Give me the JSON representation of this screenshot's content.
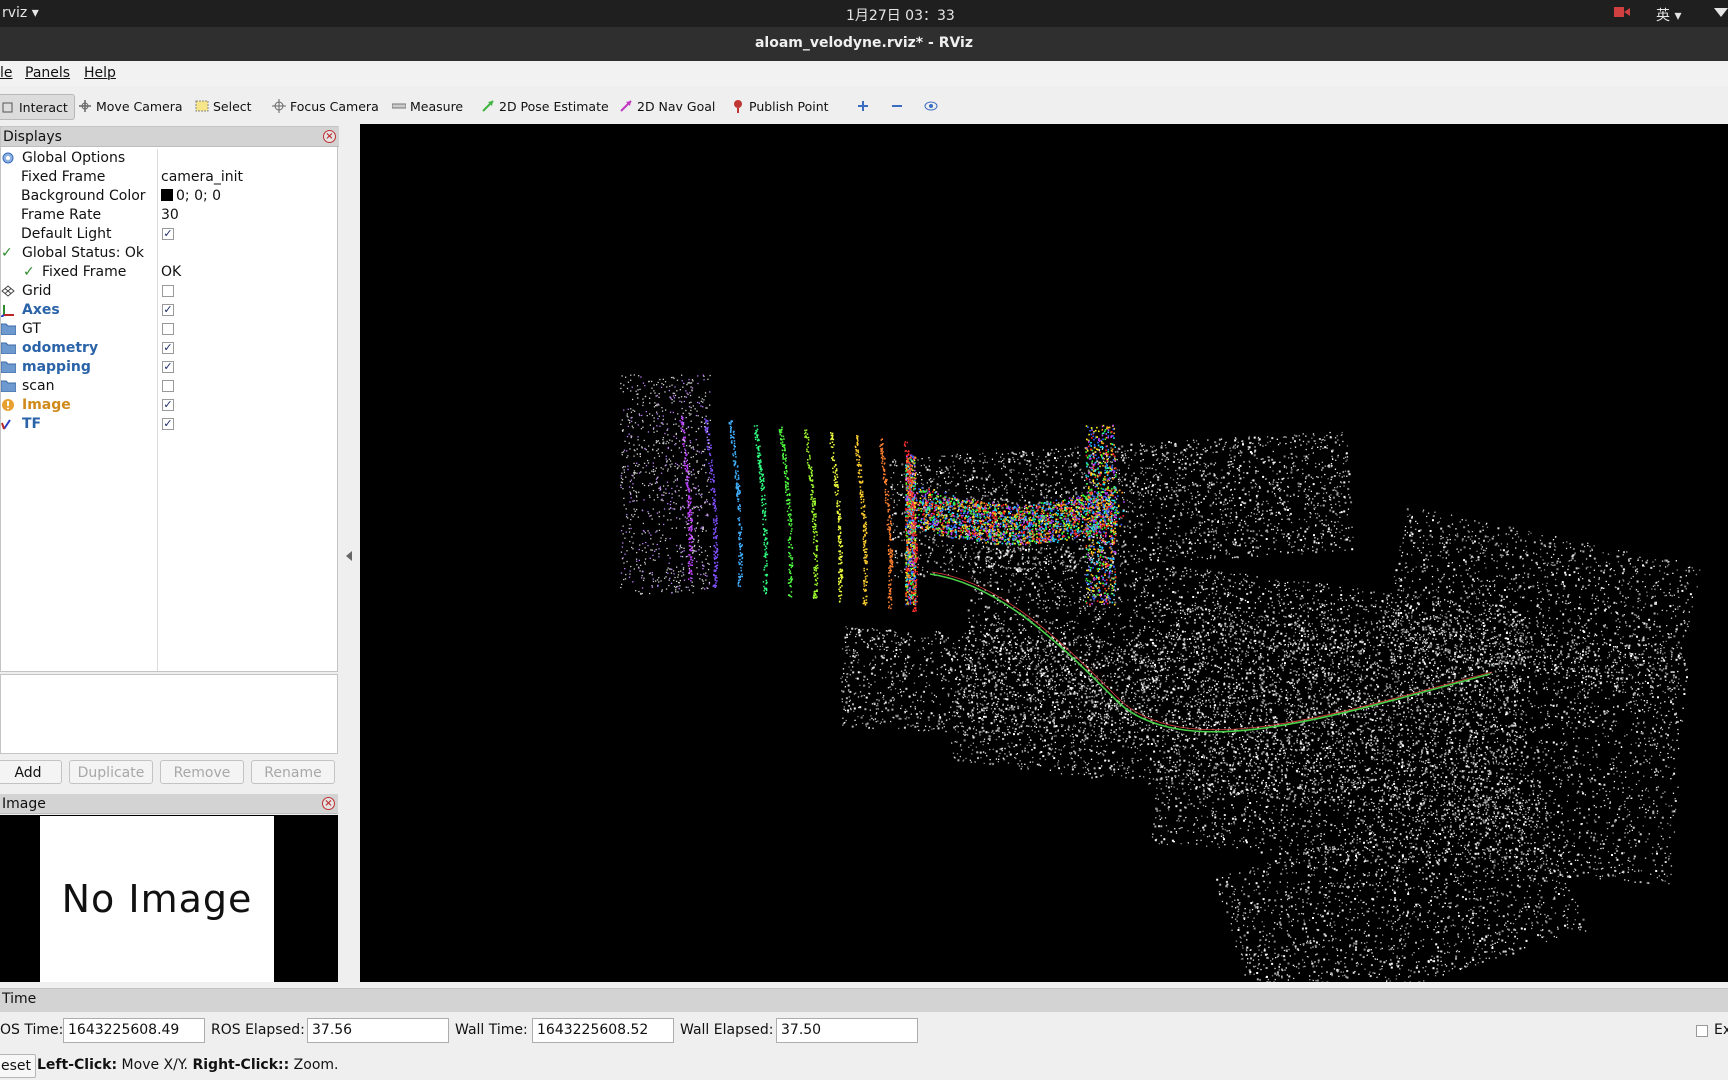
{
  "system_bar": {
    "app_menu": "rviz ▾",
    "clock": "1月27日 03：33",
    "input_method": "英 ▾"
  },
  "window": {
    "title": "aloam_velodyne.rviz* - RViz"
  },
  "menu": {
    "file": "le",
    "panels": "Panels",
    "help": "Help"
  },
  "toolbar": {
    "interact": "Interact",
    "move_camera": "Move Camera",
    "select": "Select",
    "focus_camera": "Focus Camera",
    "measure": "Measure",
    "pose_estimate": "2D Pose Estimate",
    "nav_goal": "2D Nav Goal",
    "publish_point": "Publish Point"
  },
  "displays": {
    "title": "Displays",
    "global_options": "Global Options",
    "fixed_frame": {
      "label": "Fixed Frame",
      "value": "camera_init"
    },
    "background_color": {
      "label": "Background Color",
      "value": "0; 0; 0"
    },
    "frame_rate": {
      "label": "Frame Rate",
      "value": "30"
    },
    "default_light": {
      "label": "Default Light",
      "checked": true
    },
    "global_status": "Global Status: Ok",
    "status_fixed_frame": {
      "label": "Fixed Frame",
      "value": "OK"
    },
    "items": [
      {
        "label": "Grid",
        "checked": false
      },
      {
        "label": "Axes",
        "checked": true
      },
      {
        "label": "GT",
        "checked": false
      },
      {
        "label": "odometry",
        "checked": true
      },
      {
        "label": "mapping",
        "checked": true
      },
      {
        "label": "scan",
        "checked": false
      },
      {
        "label": "Image",
        "checked": true
      },
      {
        "label": "TF",
        "checked": true
      }
    ],
    "add": "Add",
    "duplicate": "Duplicate",
    "remove": "Remove",
    "rename": "Rename"
  },
  "image_panel": {
    "title": "Image",
    "placeholder": "No Image"
  },
  "time_panel": {
    "title": "Time",
    "ros_time_label": "OS Time:",
    "ros_time": "1643225608.49",
    "ros_elapsed_label": "ROS Elapsed:",
    "ros_elapsed": "37.56",
    "wall_time_label": "Wall Time:",
    "wall_time": "1643225608.52",
    "wall_elapsed_label": "Wall Elapsed:",
    "wall_elapsed": "37.50",
    "experimental": "Ex"
  },
  "status": {
    "reset": "eset",
    "hint_left_bold": "Left-Click:",
    "hint_left": " Move X/Y.",
    "hint_right_bold": "Right-Click::",
    "hint_right": " Zoom."
  },
  "colors": {
    "viewport_bg": "#000000",
    "link_blue": "#2a63a8",
    "warning_orange": "#d08a1a"
  }
}
